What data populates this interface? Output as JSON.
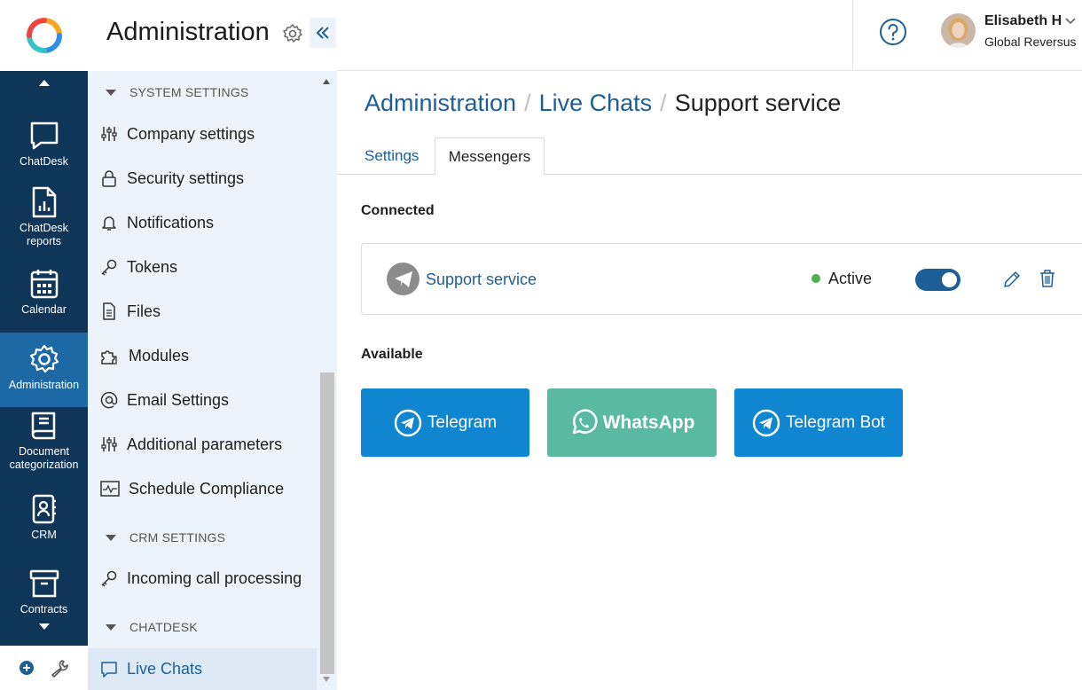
{
  "rail": {
    "items": [
      {
        "label": "ChatDesk"
      },
      {
        "label": "ChatDesk reports"
      },
      {
        "label": "Calendar"
      },
      {
        "label": "Administration"
      },
      {
        "label": "Document categorization"
      },
      {
        "label": "CRM"
      },
      {
        "label": "Contracts"
      }
    ]
  },
  "sidebar": {
    "title": "Administration",
    "sections": {
      "system": "SYSTEM SETTINGS",
      "crm": "CRM SETTINGS",
      "chatdesk": "CHATDESK"
    },
    "items": [
      {
        "label": "Company settings"
      },
      {
        "label": "Security settings"
      },
      {
        "label": "Notifications"
      },
      {
        "label": "Tokens"
      },
      {
        "label": "Files"
      },
      {
        "label": "Modules"
      },
      {
        "label": "Email Settings"
      },
      {
        "label": "Additional parameters"
      },
      {
        "label": "Schedule Compliance"
      },
      {
        "label": "Incoming call processing"
      },
      {
        "label": "Live Chats"
      }
    ]
  },
  "user": {
    "name": "Elisabeth H",
    "org": "Global Reversus"
  },
  "breadcrumb": {
    "items": [
      "Administration",
      "Live Chats"
    ],
    "current": "Support service",
    "separator": "/"
  },
  "tabs": {
    "settings": "Settings",
    "messengers": "Messengers"
  },
  "connected": {
    "heading": "Connected",
    "channel": {
      "name": "Support service",
      "status": "Active",
      "enabled": true
    }
  },
  "available": {
    "heading": "Available",
    "messengers": [
      {
        "label": "Telegram"
      },
      {
        "label": "WhatsApp"
      },
      {
        "label": "Telegram Bot"
      }
    ]
  },
  "colors": {
    "rail": "#0f3559",
    "rail_active": "#1d69a6",
    "link": "#1d5e96",
    "telegram": "#0f86cf",
    "whatsapp": "#59b9a1",
    "status_active": "#4caf50"
  }
}
